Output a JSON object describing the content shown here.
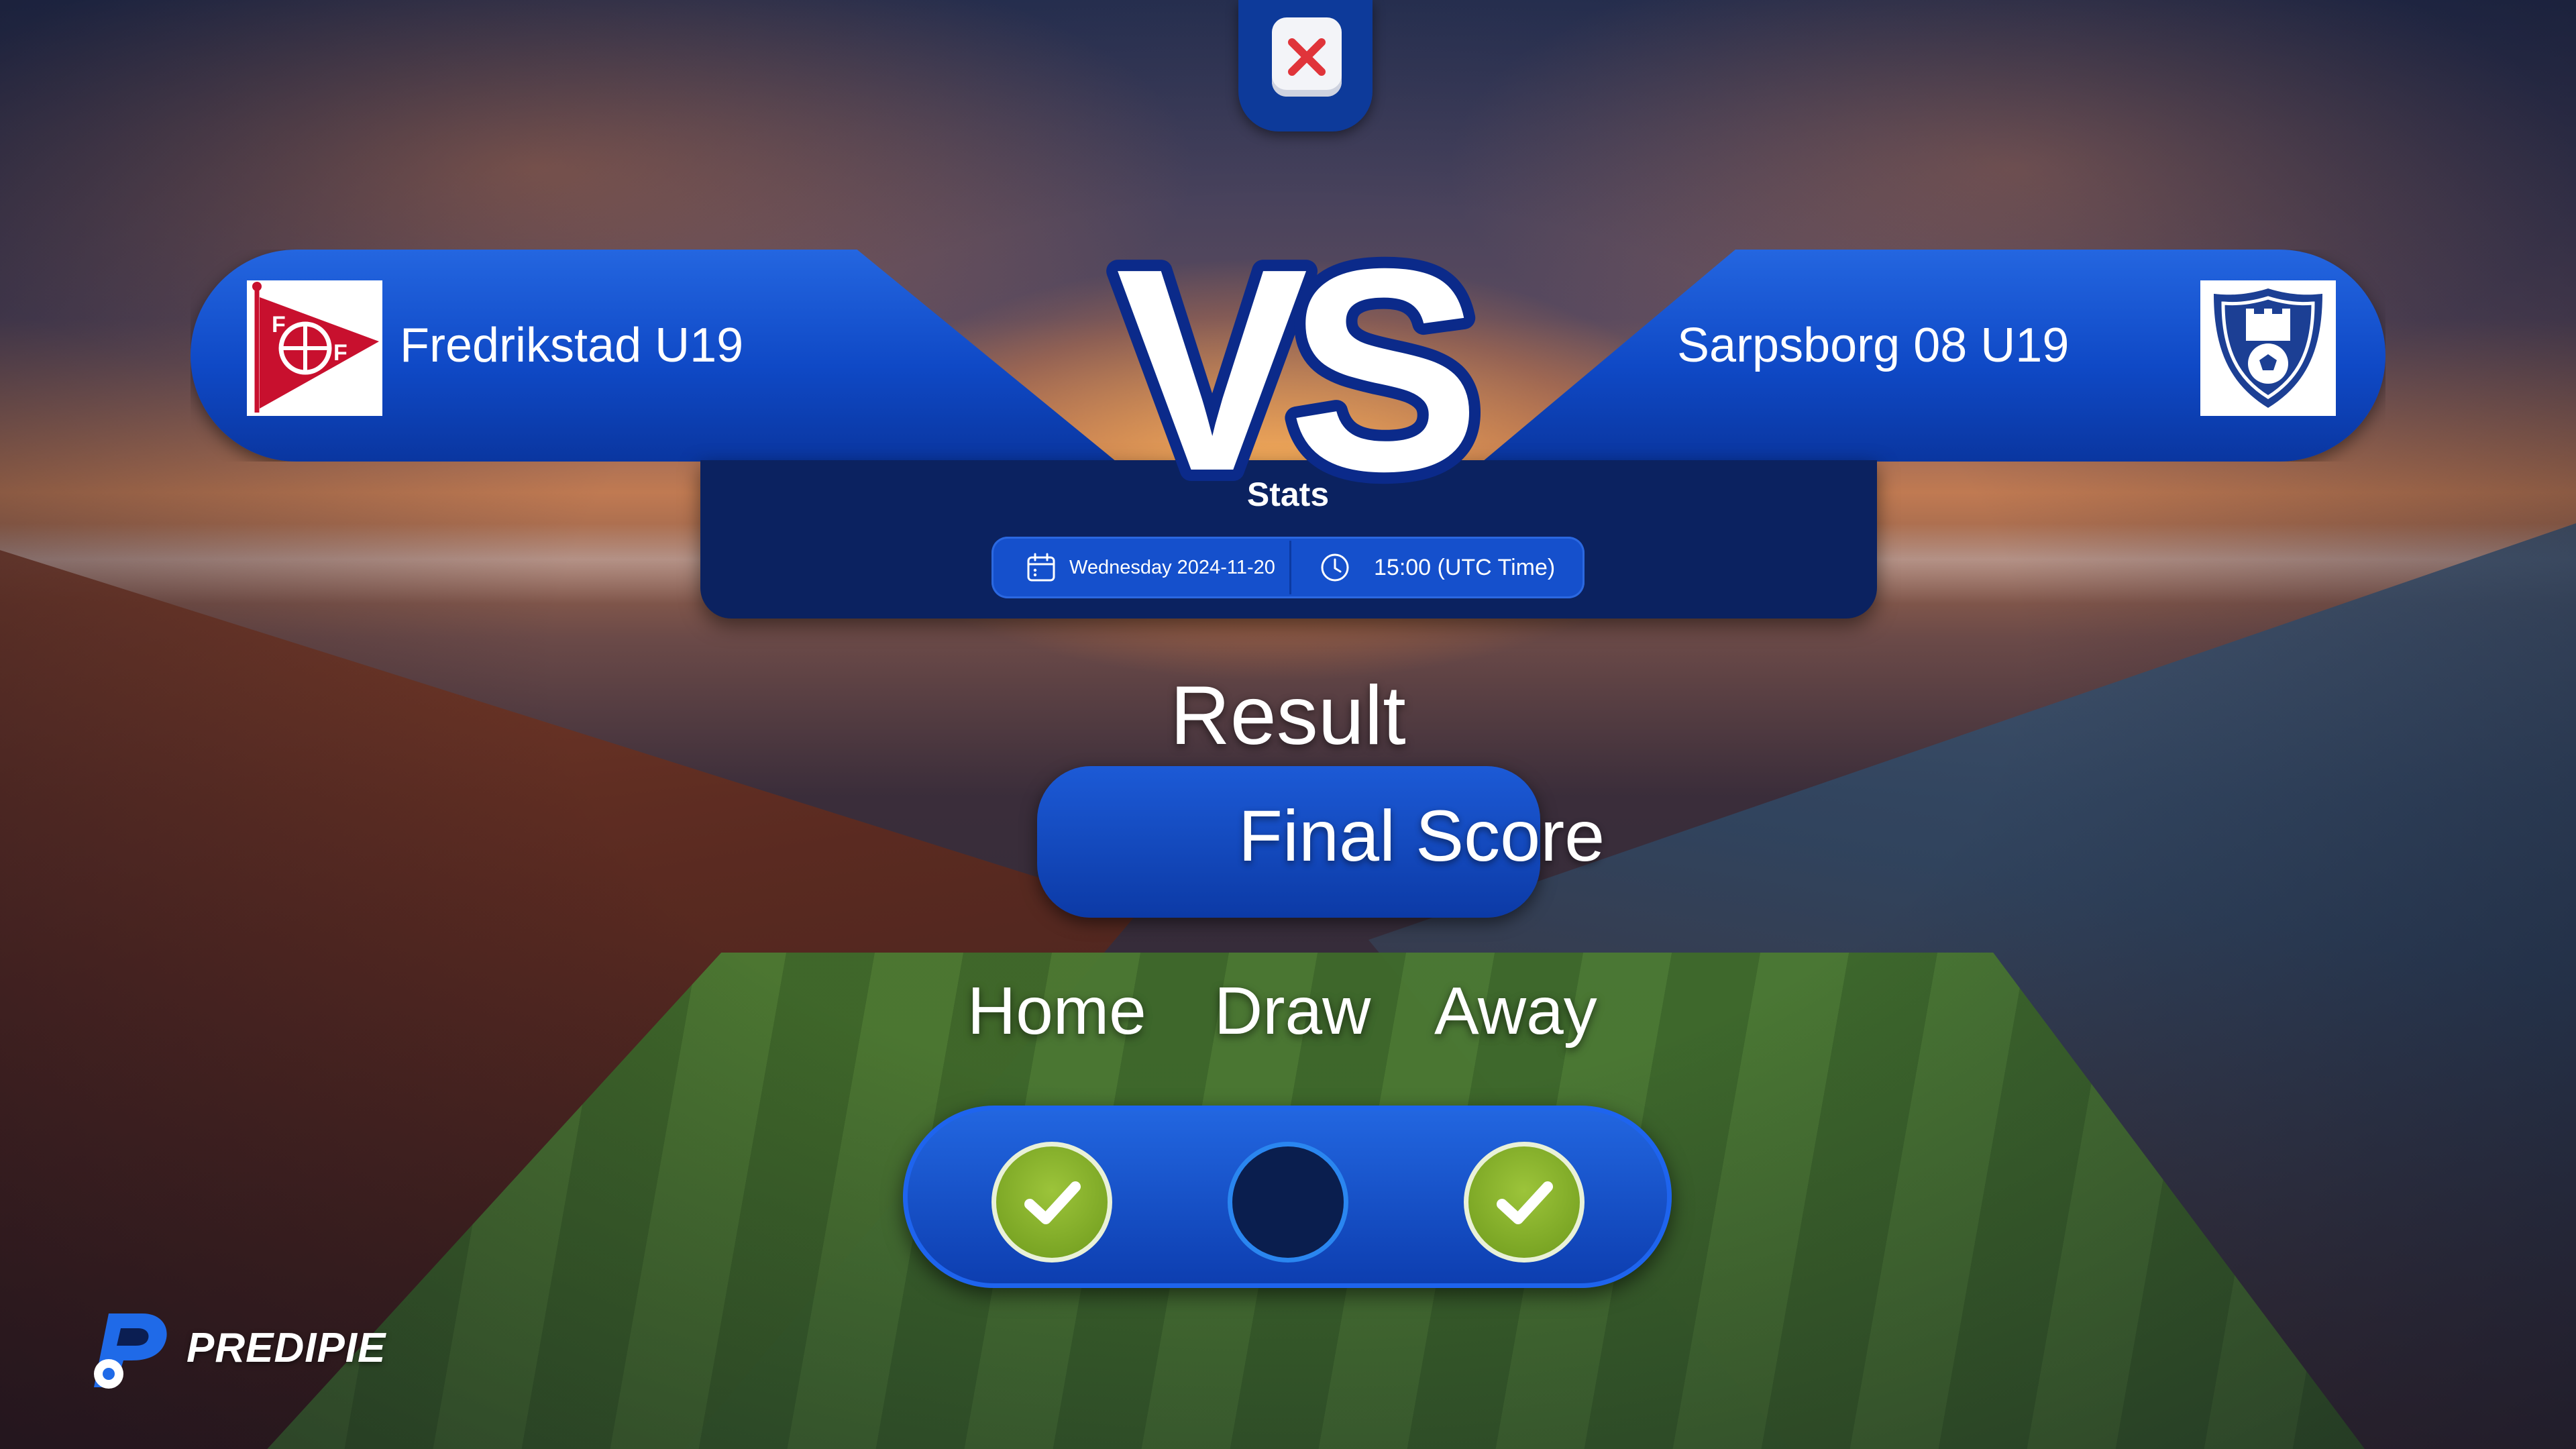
{
  "match": {
    "home_team": "Fredrikstad U19",
    "away_team": "Sarpsborg 08 U19",
    "vs_text": "VS",
    "stats_label": "Stats",
    "date": "Wednesday 2024-11-20",
    "time": "15:00 (UTC Time)"
  },
  "result": {
    "title": "Result",
    "score_label": "Final Score",
    "outcomes": [
      {
        "label": "Home",
        "selected": true
      },
      {
        "label": "Draw",
        "selected": false
      },
      {
        "label": "Away",
        "selected": true
      }
    ]
  },
  "brand": {
    "name": "PREDIPIE"
  },
  "icons": {
    "close": "close-icon",
    "calendar": "calendar-icon",
    "clock": "clock-icon",
    "check": "check-icon",
    "home_logo": "fredrikstad-crest",
    "away_logo": "sarpsborg-crest",
    "brand_logo": "predipie-logo"
  },
  "colors": {
    "accent_blue": "#0f49c6",
    "panel_navy": "#0b2260",
    "check_green": "#7fac24",
    "close_red": "#e0343a"
  }
}
